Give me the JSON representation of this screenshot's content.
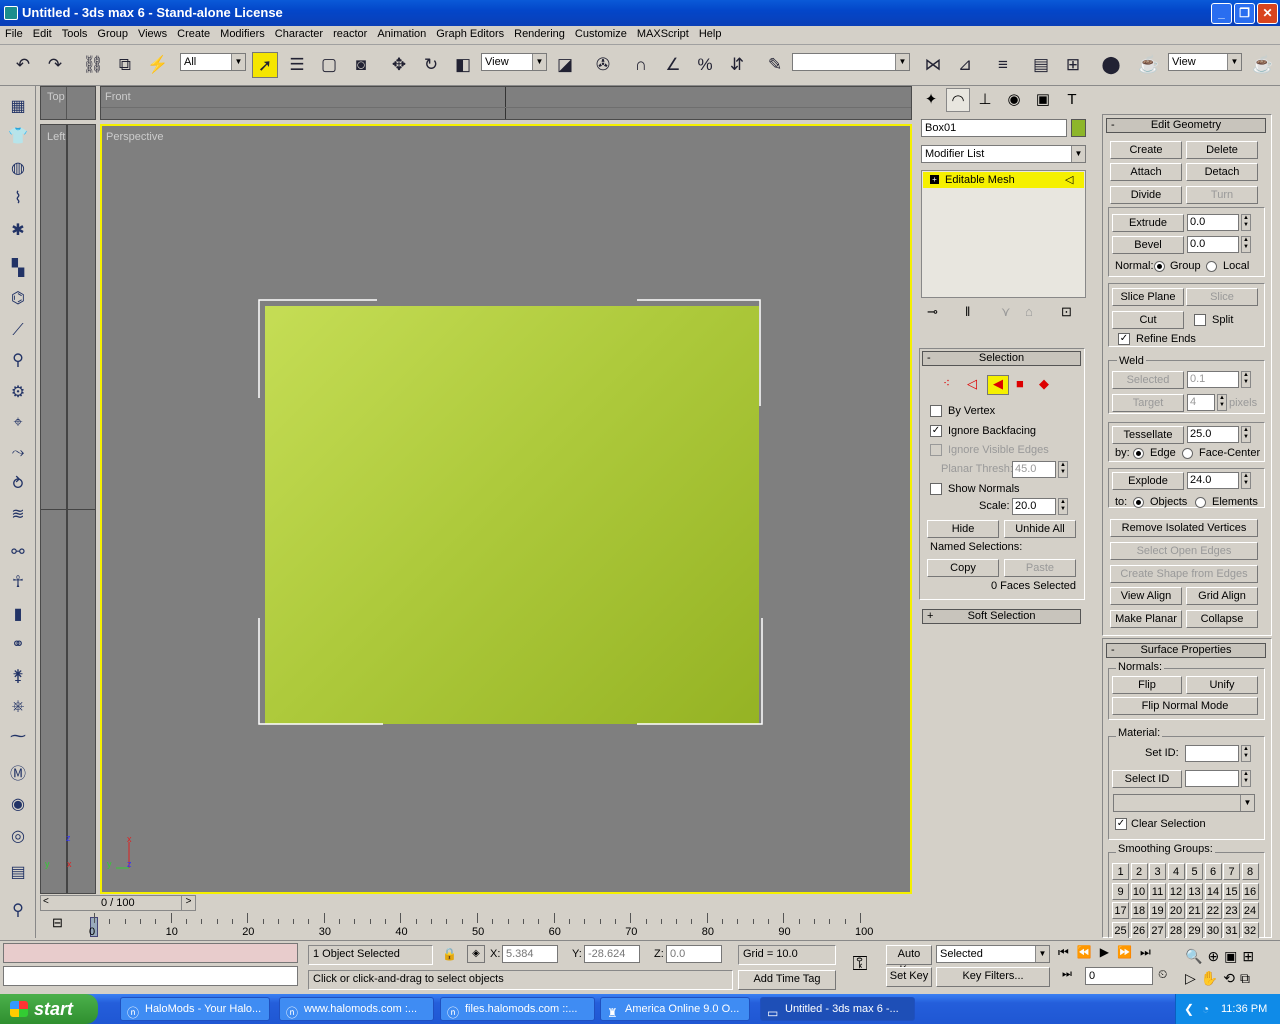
{
  "window": {
    "title": "Untitled - 3ds max 6 - Stand-alone License"
  },
  "menu": [
    "File",
    "Edit",
    "Tools",
    "Group",
    "Views",
    "Create",
    "Modifiers",
    "Character",
    "reactor",
    "Animation",
    "Graph Editors",
    "Rendering",
    "Customize",
    "MAXScript",
    "Help"
  ],
  "toolbar": {
    "filter_value": "All",
    "ref_coord_value": "View",
    "named_sel_value": "",
    "render_type_value": "View"
  },
  "viewports": {
    "top": "Top",
    "front": "Front",
    "left": "Left",
    "perspective": "Perspective"
  },
  "axes": {
    "x": "x",
    "y": "y",
    "z": "z"
  },
  "command_panel": {
    "object_name": "Box01",
    "object_color": "#8db62a",
    "modifier_list": "Modifier List",
    "stack_item": "Editable Mesh",
    "selection": {
      "title": "Selection",
      "by_vertex": "By Vertex",
      "ignore_backfacing": "Ignore Backfacing",
      "ignore_visible_edges": "Ignore Visible Edges",
      "planar_thresh": "Planar Thresh:",
      "planar_value": "45.0",
      "show_normals": "Show Normals",
      "scale": "Scale:",
      "scale_value": "20.0",
      "hide": "Hide",
      "unhide_all": "Unhide All",
      "named_selections": "Named Selections:",
      "copy": "Copy",
      "paste": "Paste",
      "status": "0 Faces Selected"
    },
    "soft_selection": "Soft Selection",
    "edit_geometry": {
      "title": "Edit Geometry",
      "create": "Create",
      "delete": "Delete",
      "attach": "Attach",
      "detach": "Detach",
      "divide": "Divide",
      "turn": "Turn",
      "extrude": "Extrude",
      "extrude_value": "0.0",
      "bevel": "Bevel",
      "bevel_value": "0.0",
      "normal": "Normal:",
      "group": "Group",
      "local": "Local",
      "slice_plane": "Slice Plane",
      "slice": "Slice",
      "cut": "Cut",
      "split": "Split",
      "refine_ends": "Refine Ends",
      "weld": "Weld",
      "selected": "Selected",
      "selected_value": "0.1",
      "target": "Target",
      "target_value": "4",
      "pixels": "pixels",
      "tessellate": "Tessellate",
      "tessellate_value": "25.0",
      "by": "by:",
      "edge": "Edge",
      "face_center": "Face-Center",
      "explode": "Explode",
      "explode_value": "24.0",
      "to": "to:",
      "objects": "Objects",
      "elements": "Elements",
      "remove_isolated": "Remove Isolated Vertices",
      "select_open_edges": "Select Open Edges",
      "create_shape": "Create Shape from Edges",
      "view_align": "View Align",
      "grid_align": "Grid Align",
      "make_planar": "Make Planar",
      "collapse": "Collapse"
    },
    "surface": {
      "title": "Surface Properties",
      "normals": "Normals:",
      "flip": "Flip",
      "unify": "Unify",
      "flip_normal_mode": "Flip Normal Mode",
      "material": "Material:",
      "set_id": "Set ID:",
      "select_id": "Select ID",
      "clear_selection": "Clear Selection",
      "smoothing_groups": "Smoothing Groups:",
      "sg_numbers": [
        "1",
        "2",
        "3",
        "4",
        "5",
        "6",
        "7",
        "8",
        "9",
        "10",
        "11",
        "12",
        "13",
        "14",
        "15",
        "16",
        "17",
        "18",
        "19",
        "20",
        "21",
        "22",
        "23",
        "24",
        "25",
        "26",
        "27",
        "28",
        "29",
        "30",
        "31",
        "32"
      ]
    }
  },
  "timeline": {
    "frame": "0 / 100",
    "ticks": [
      "0",
      "10",
      "20",
      "30",
      "40",
      "50",
      "60",
      "70",
      "80",
      "90",
      "100"
    ]
  },
  "status": {
    "objects_selected": "1 Object Selected",
    "x_label": "X:",
    "x_value": "5.384",
    "y_label": "Y:",
    "y_value": "-28.624",
    "z_label": "Z:",
    "z_value": "0.0",
    "grid": "Grid = 10.0",
    "prompt": "Click or click-and-drag to select objects",
    "add_time_tag": "Add Time Tag",
    "auto_key": "Auto Key",
    "set_key": "Set Key",
    "key_mode": "Selected",
    "key_filters": "Key Filters...",
    "frame_value": "0"
  },
  "taskbar": {
    "start": "start",
    "tasks": [
      "HaloMods - Your Halo...",
      "www.halomods.com :...",
      "files.halomods.com ::...",
      "America Online 9.0 O...",
      "Untitled - 3ds max 6 -..."
    ],
    "clock": "11:36 PM"
  }
}
